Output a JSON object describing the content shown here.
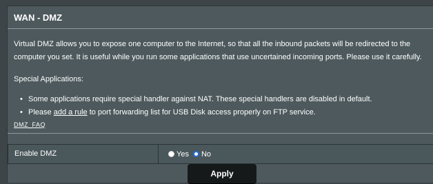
{
  "header": {
    "title": "WAN - DMZ"
  },
  "description": {
    "text": "Virtual DMZ allows you to expose one computer to the Internet, so that all the inbound packets will be redirected to the computer you set. It is useful while you run some applications that use uncertained incoming ports. Please use it carefully."
  },
  "special_applications": {
    "title": "Special Applications:",
    "bullet": "•",
    "note_1": "Some applications require special handler against NAT. These special handlers are disabled in default.",
    "note_2_prefix": "Please ",
    "note_2_link": "add a rule",
    "note_2_suffix": " to port forwarding list for USB Disk access properly on FTP service."
  },
  "faq": {
    "label": "DMZ_FAQ"
  },
  "settings": {
    "enable_dmz_label": "Enable DMZ",
    "options": [
      {
        "label": "Yes",
        "selected": false
      },
      {
        "label": "No",
        "selected": true
      }
    ]
  },
  "actions": {
    "apply_label": "Apply"
  },
  "colors": {
    "background": "#3e4549",
    "panel": "#4d595d",
    "accent_radio": "#1e6fe0",
    "button": "#16191a"
  }
}
